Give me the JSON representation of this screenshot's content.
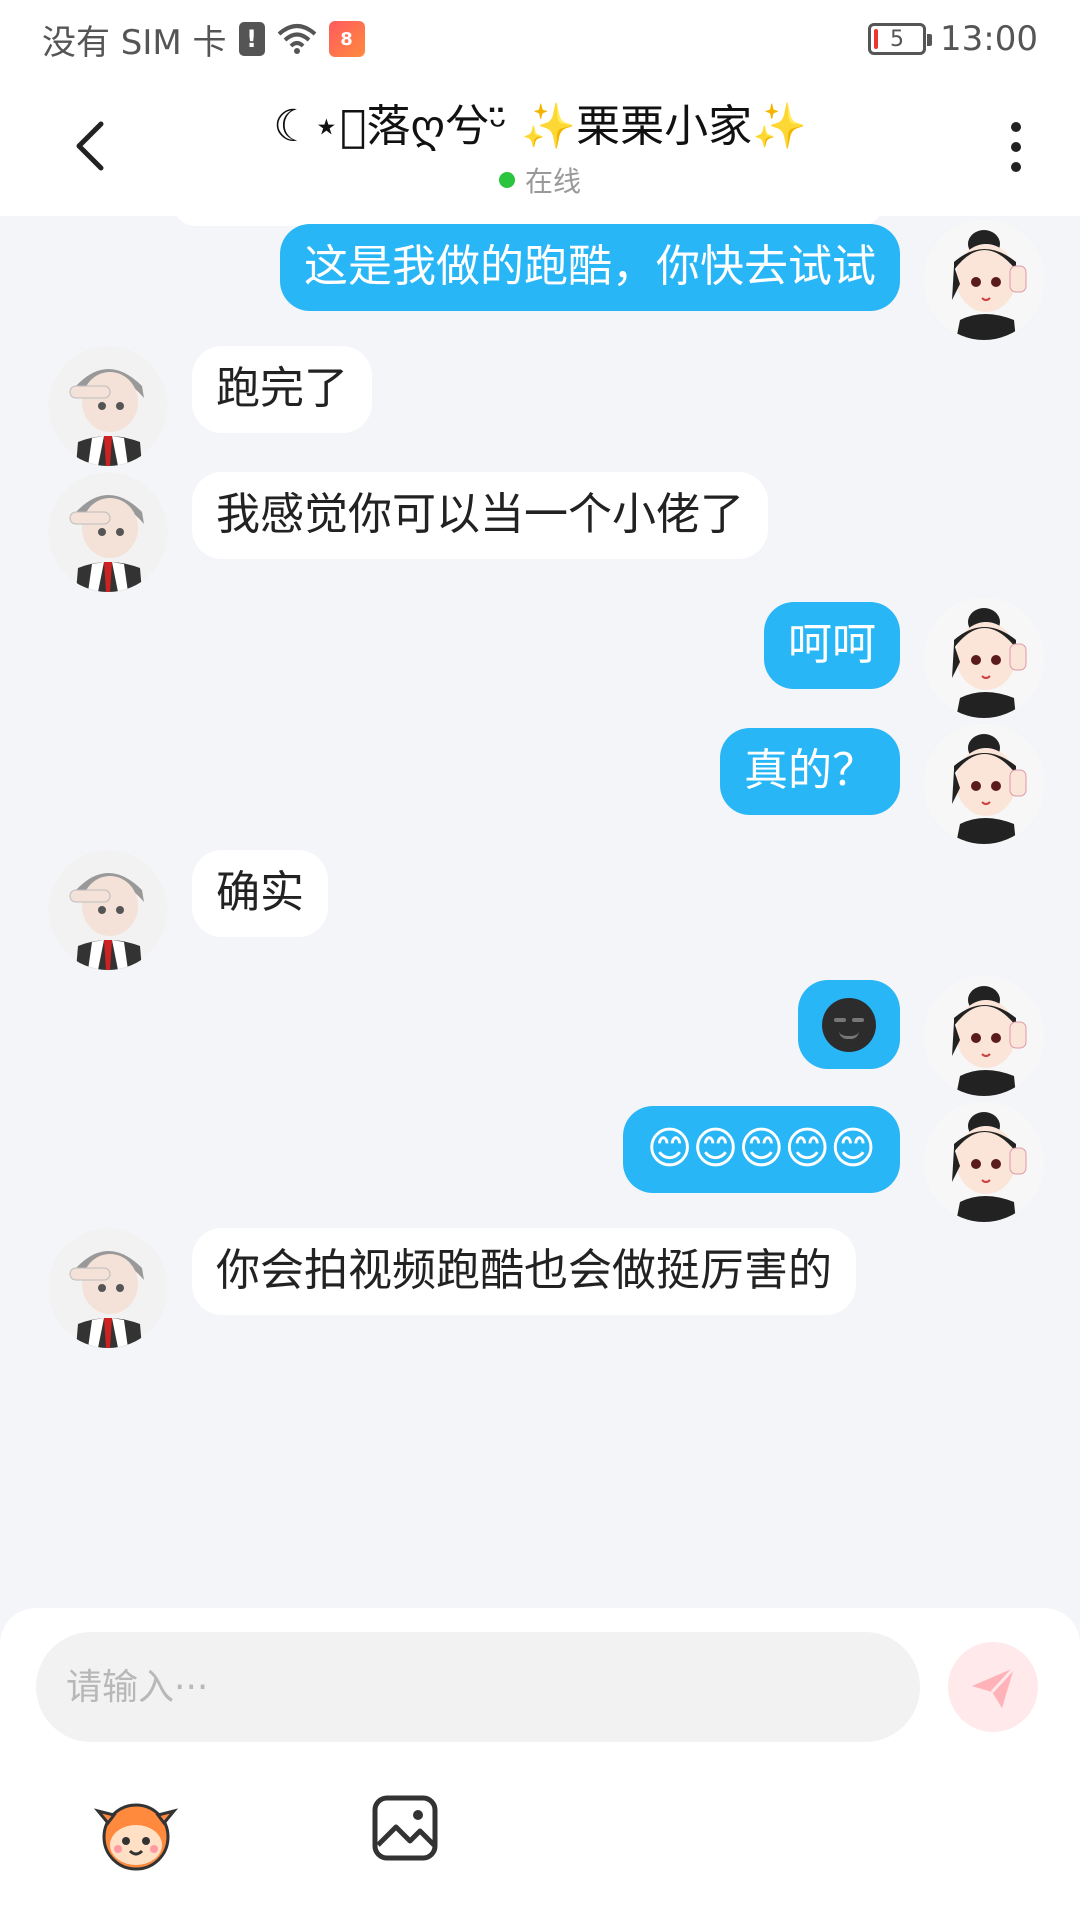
{
  "status_bar": {
    "carrier": "没有 SIM 卡",
    "sim_alert": "!",
    "app_badge": "8",
    "battery": "5",
    "battery_percent": 5,
    "time": "13:00"
  },
  "header": {
    "title": "☾⋆⃢落ღ兮ᵕ̈ ✨栗栗小家✨",
    "status": "在线",
    "status_color": "#2ac43f"
  },
  "messages": [
    {
      "sender": "me",
      "text": "这是我做的跑酷，你快去试试"
    },
    {
      "sender": "other",
      "text": "跑完了"
    },
    {
      "sender": "other",
      "text": "我感觉你可以当一个小佬了"
    },
    {
      "sender": "me",
      "text": "呵呵"
    },
    {
      "sender": "me",
      "text": "真的？"
    },
    {
      "sender": "other",
      "text": "确实"
    },
    {
      "sender": "me",
      "text": "",
      "emoji": "smirk-dark-emoji"
    },
    {
      "sender": "me",
      "text": "😊😊😊😊😊"
    },
    {
      "sender": "other",
      "text": "你会拍视频跑酷也会做挺厉害的"
    }
  ],
  "input": {
    "placeholder": "请输入···",
    "value": ""
  },
  "colors": {
    "my_bubble": "#29b6f6",
    "other_bubble": "#ffffff",
    "background": "#f3f5f8",
    "send_button": "#ffe9ea"
  },
  "icons": {
    "back": "back-arrow-icon",
    "more": "more-vertical-icon",
    "send": "send-plane-icon",
    "sticker": "sticker-mascot-icon",
    "image": "image-gallery-icon"
  }
}
